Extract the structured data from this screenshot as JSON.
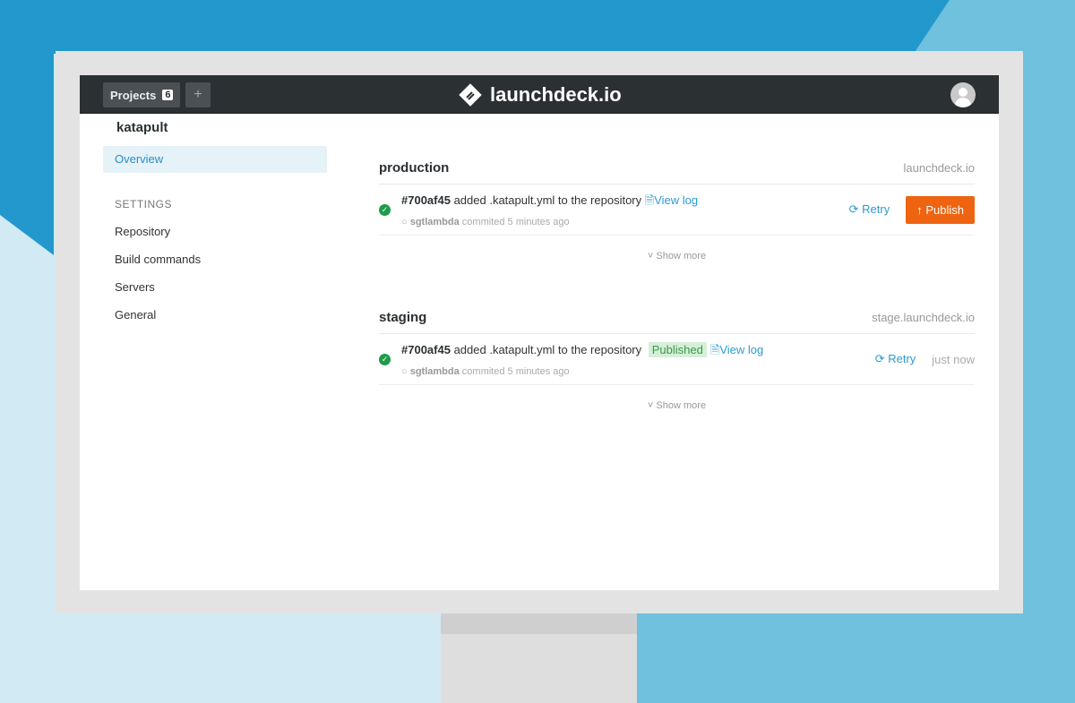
{
  "topbar": {
    "projects_label": "Projects",
    "projects_count": "6",
    "add_label": "+",
    "brand": "launchdeck.io"
  },
  "sidebar": {
    "project": "katapult",
    "overview": "Overview",
    "settings_heading": "SETTINGS",
    "items": [
      "Repository",
      "Build commands",
      "Servers",
      "General"
    ]
  },
  "environments": [
    {
      "name": "production",
      "url": "launchdeck.io",
      "commit": "#700af45",
      "message": "added .katapult.yml to the repository",
      "view_log": "View log",
      "author": "sgtlambda",
      "committed": "commited 5 minutes ago",
      "retry": "Retry",
      "publish": "Publish",
      "show_more": "Show more"
    },
    {
      "name": "staging",
      "url": "stage.launchdeck.io",
      "commit": "#700af45",
      "message": "added .katapult.yml to the repository",
      "badge": "Published",
      "view_log": "View log",
      "author": "sgtlambda",
      "committed": "commited 5 minutes ago",
      "retry": "Retry",
      "time": "just now",
      "show_more": "Show more"
    }
  ],
  "colors": {
    "accent": "#2d9bd0",
    "publish": "#ee6410",
    "success": "#1e9c4a"
  }
}
